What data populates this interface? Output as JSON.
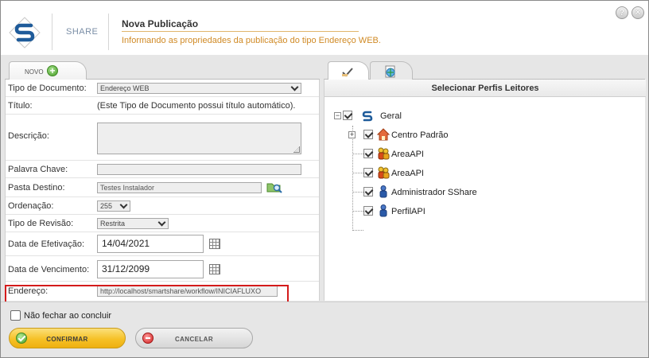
{
  "header": {
    "brand": "SHARE",
    "title": "Nova Publicação",
    "subtitle": "Informando as propriedades da publicação do tipo Endereço WEB.",
    "help_label": "?",
    "close_label": "✕"
  },
  "left_tab": {
    "label": "NOVO",
    "plus": "+"
  },
  "form": {
    "tipo_documento": {
      "label": "Tipo de Documento:",
      "value": "Endereço WEB"
    },
    "titulo": {
      "label": "Título:",
      "value": "(Este Tipo de Documento possui título automático)."
    },
    "descricao": {
      "label": "Descrição:",
      "value": ""
    },
    "palavra_chave": {
      "label": "Palavra Chave:",
      "value": ""
    },
    "pasta_destino": {
      "label": "Pasta Destino:",
      "value": "Testes Instalador"
    },
    "ordenacao": {
      "label": "Ordenação:",
      "value": "255"
    },
    "tipo_revisao": {
      "label": "Tipo de Revisão:",
      "value": "Restrita"
    },
    "data_efetivacao": {
      "label": "Data de Efetivação:",
      "value": "14/04/2021"
    },
    "data_vencimento": {
      "label": "Data de Vencimento:",
      "value": "31/12/2099"
    },
    "endereco": {
      "label": "Endereço:",
      "value": "http://localhost/smartshare/workflow/INICIAFLUXO"
    }
  },
  "right_panel": {
    "header": "Selecionar Perfis Leitores",
    "tree": {
      "root": {
        "label": "Geral",
        "expander": "−"
      },
      "children": [
        {
          "label": "Centro Padrão",
          "icon": "house-icon",
          "expander": "+"
        },
        {
          "label": "AreaAPI",
          "icon": "group-users-icon"
        },
        {
          "label": "AreaAPI",
          "icon": "group-users-icon"
        },
        {
          "label": "Administrador SShare",
          "icon": "user-icon"
        },
        {
          "label": "PerfilAPI",
          "icon": "user-icon"
        }
      ]
    }
  },
  "footer": {
    "keep_open_label": "Não fechar ao concluir",
    "confirm_label": "CONFIRMAR",
    "cancel_label": "CANCELAR"
  },
  "colors": {
    "accent_orange": "#d08a25",
    "confirm_yellow": "#f6c127",
    "highlight_red": "#d41b1b",
    "brand_blue": "#1e5b9a"
  }
}
